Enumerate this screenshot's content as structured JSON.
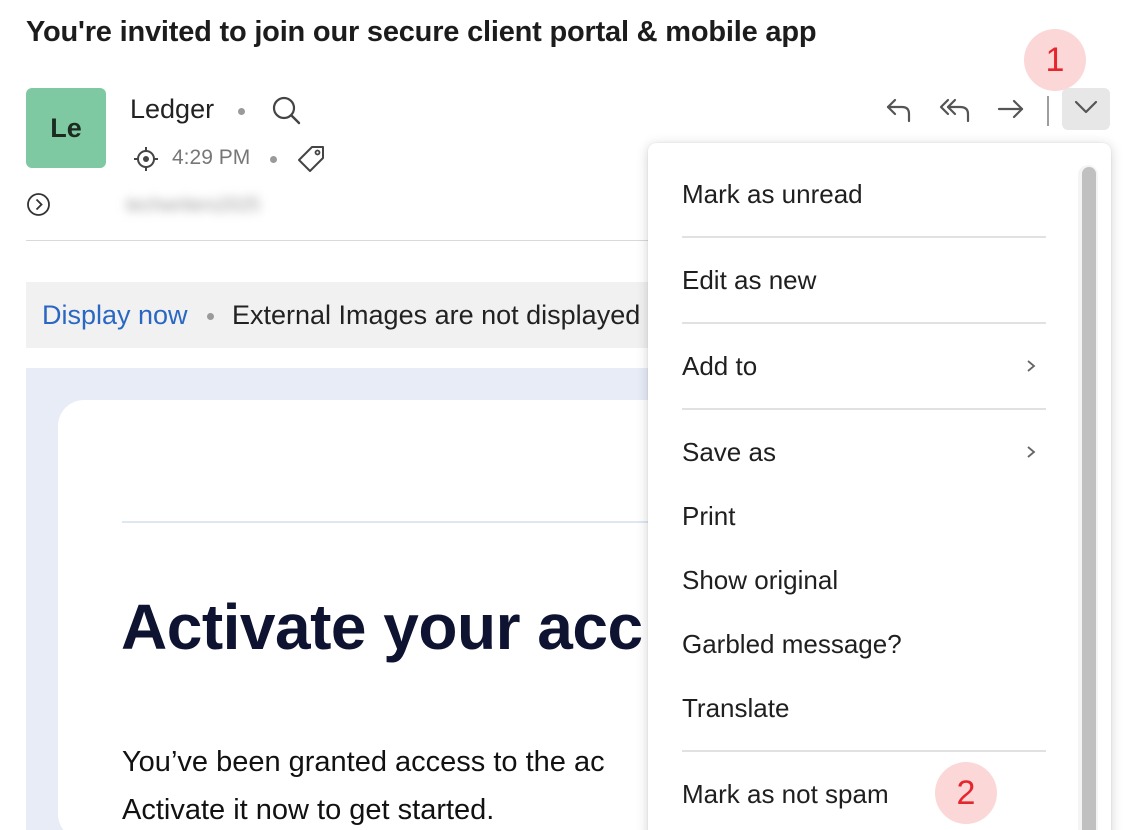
{
  "email": {
    "subject": "You're invited to join our secure client portal & mobile app",
    "sender": {
      "avatar_initials": "Le",
      "avatar_color": "#7fc9a2",
      "name": "Ledger",
      "time": "4:29 PM",
      "email_blurred": "techwriters2025"
    },
    "icons": {
      "sender_search": "search-icon",
      "time_target": "target-icon",
      "tag": "tag-icon",
      "expand": "chevron-right-circle-icon",
      "reply": "reply-icon",
      "reply_all": "reply-all-icon",
      "forward": "forward-icon",
      "more": "chevron-down-icon"
    }
  },
  "images_bar": {
    "display_now": "Display now",
    "note": "External Images are not displayed"
  },
  "content": {
    "title": "Activate your acc",
    "body_line1": "You’ve been granted access to the ac",
    "body_line2": "Activate it now to get started."
  },
  "annotations": {
    "step1": "1",
    "step2": "2",
    "badge_color": "#e6262d"
  },
  "menu": {
    "items": [
      {
        "label": "Mark as unread"
      },
      {
        "label": "Edit as new"
      },
      {
        "label": "Add to",
        "submenu": true
      },
      {
        "label": "Save as",
        "submenu": true
      },
      {
        "label": "Print"
      },
      {
        "label": "Show original"
      },
      {
        "label": "Garbled message?"
      },
      {
        "label": "Translate"
      },
      {
        "label": "Mark as not spam"
      }
    ]
  },
  "colors": {
    "link": "#2a67c3",
    "title_text": "#0d1330"
  }
}
